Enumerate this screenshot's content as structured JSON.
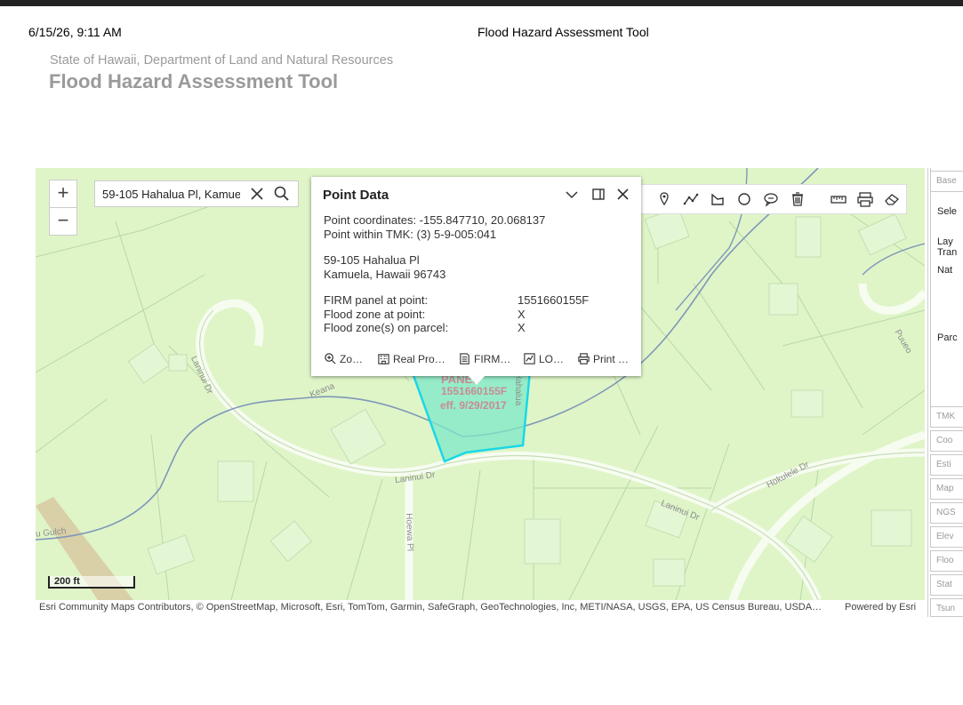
{
  "print_header": {
    "datetime": "6/15/26, 9:11 AM",
    "title": "Flood Hazard Assessment Tool"
  },
  "app": {
    "agency": "State of Hawaii, Department of Land and Natural Resources",
    "title": "Flood Hazard Assessment Tool"
  },
  "zoom": {
    "in": "+",
    "out": "−"
  },
  "search": {
    "value": "59-105 Hahalua Pl, Kamuela"
  },
  "toolbar": {
    "tools": [
      "pin-icon",
      "polyline-icon",
      "polygon-icon",
      "circle-icon",
      "comment-icon",
      "trash-icon",
      "measure-icon",
      "print-map-icon",
      "eraser-icon"
    ]
  },
  "popup": {
    "title": "Point Data",
    "coordinates": "Point coordinates: -155.847710, 20.068137",
    "tmk": "Point within TMK: (3) 5-9-005:041",
    "address_line1": "59-105 Hahalua Pl",
    "address_line2": "Kamuela, Hawaii 96743",
    "firm_panel_label": "FIRM panel at point:",
    "firm_panel_value": "1551660155F",
    "flood_zone_label": "Flood zone at point:",
    "flood_zone_value": "X",
    "flood_zones_parcel_label": "Flood zone(s) on parcel:",
    "flood_zones_parcel_value": "X",
    "actions": [
      {
        "label": "Zo…",
        "icon": "zoom-icon"
      },
      {
        "label": "Real Pro…",
        "icon": "building-icon"
      },
      {
        "label": "FIRM…",
        "icon": "document-icon"
      },
      {
        "label": "LO…",
        "icon": "map-check-icon"
      },
      {
        "label": "Print …",
        "icon": "print-icon"
      }
    ]
  },
  "map": {
    "parcel_label_line1": "PANEL",
    "parcel_label_line2": "1551660155F",
    "parcel_label_line3": "eff. 9/29/2017",
    "streets": {
      "laninui_dr_1": "Laninui Dr",
      "laninui_dr_2": "Laninui Dr",
      "laninui_dr_3": "Laninui Dr",
      "hokulele_dr": "Hokulele Dr",
      "hoewa_pl": "Hoewa Pl",
      "puueo": "Puueo",
      "keana": "Keana",
      "hahalua": "Hahalua",
      "gulch": "u Gulch"
    },
    "scale": "200 ft",
    "attribution": "Esri Community Maps Contributors, © OpenStreetMap, Microsoft, Esri, TomTom, Garmin, SafeGraph, GeoTechnologies, Inc, METI/NASA, USGS, EPA, US Census Bureau, USDA…",
    "powered_by": "Powered by Esri"
  },
  "side_panel": {
    "tabs_top": [
      "Base",
      "Sele",
      "Lay",
      "Tran",
      "Nat",
      "Parc"
    ],
    "tabs": [
      "TMK",
      "Coo",
      "Esti",
      "Map",
      "NGS",
      "Elev",
      "Floo",
      "Stat",
      "Tsun"
    ]
  },
  "colors": {
    "map_background": "#dff5c8",
    "parcel_fill": "#7ee8c8",
    "parcel_outline": "#19d8e8",
    "flood_line": "#7f97b8"
  }
}
